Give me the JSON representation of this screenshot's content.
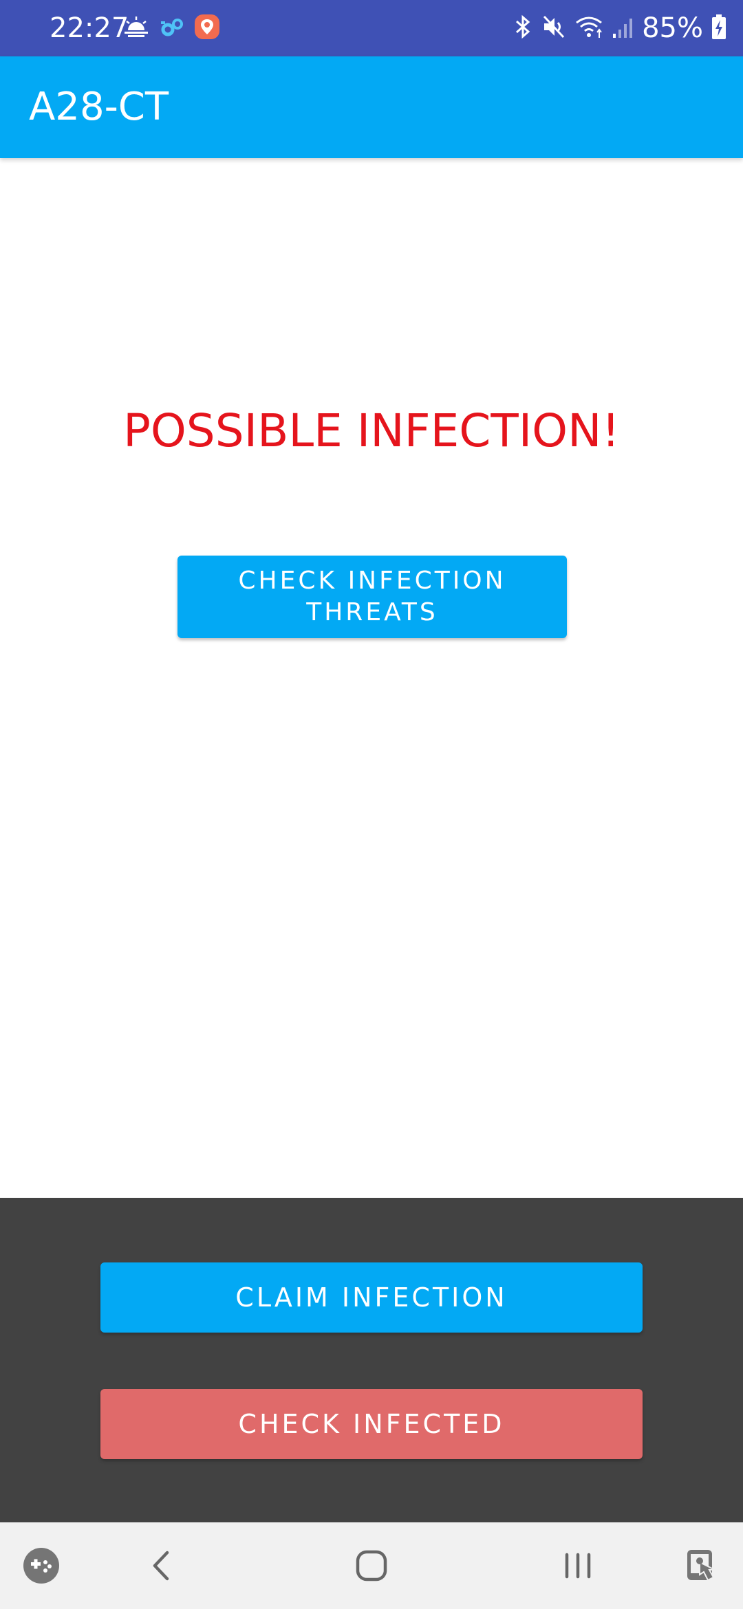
{
  "status_bar": {
    "time": "22:27",
    "battery": "85%",
    "left_icons": [
      "weather-icon",
      "settings-sync-icon",
      "location-app-icon"
    ],
    "right_icons": [
      "bluetooth-icon",
      "mute-icon",
      "wifi-icon",
      "signal-icon",
      "battery-charging-icon"
    ]
  },
  "app_bar": {
    "title": "A28-CT"
  },
  "main": {
    "infection_status": "POSSIBLE INFECTION!",
    "check_threats_label": "CHECK INFECTION\nTHREATS"
  },
  "bottom_panel": {
    "claim_label": "CLAIM INFECTION",
    "check_infected_label": "CHECK INFECTED"
  },
  "nav_bar": {
    "items": [
      "game-launcher-icon",
      "back-icon",
      "home-icon",
      "recents-icon",
      "touch-protection-icon"
    ]
  },
  "colors": {
    "status_bar": "#3f51b5",
    "app_bar": "#03a9f4",
    "alert_text": "#e5141c",
    "bottom_panel": "#424242",
    "check_infected_button": "#e06a6a"
  }
}
